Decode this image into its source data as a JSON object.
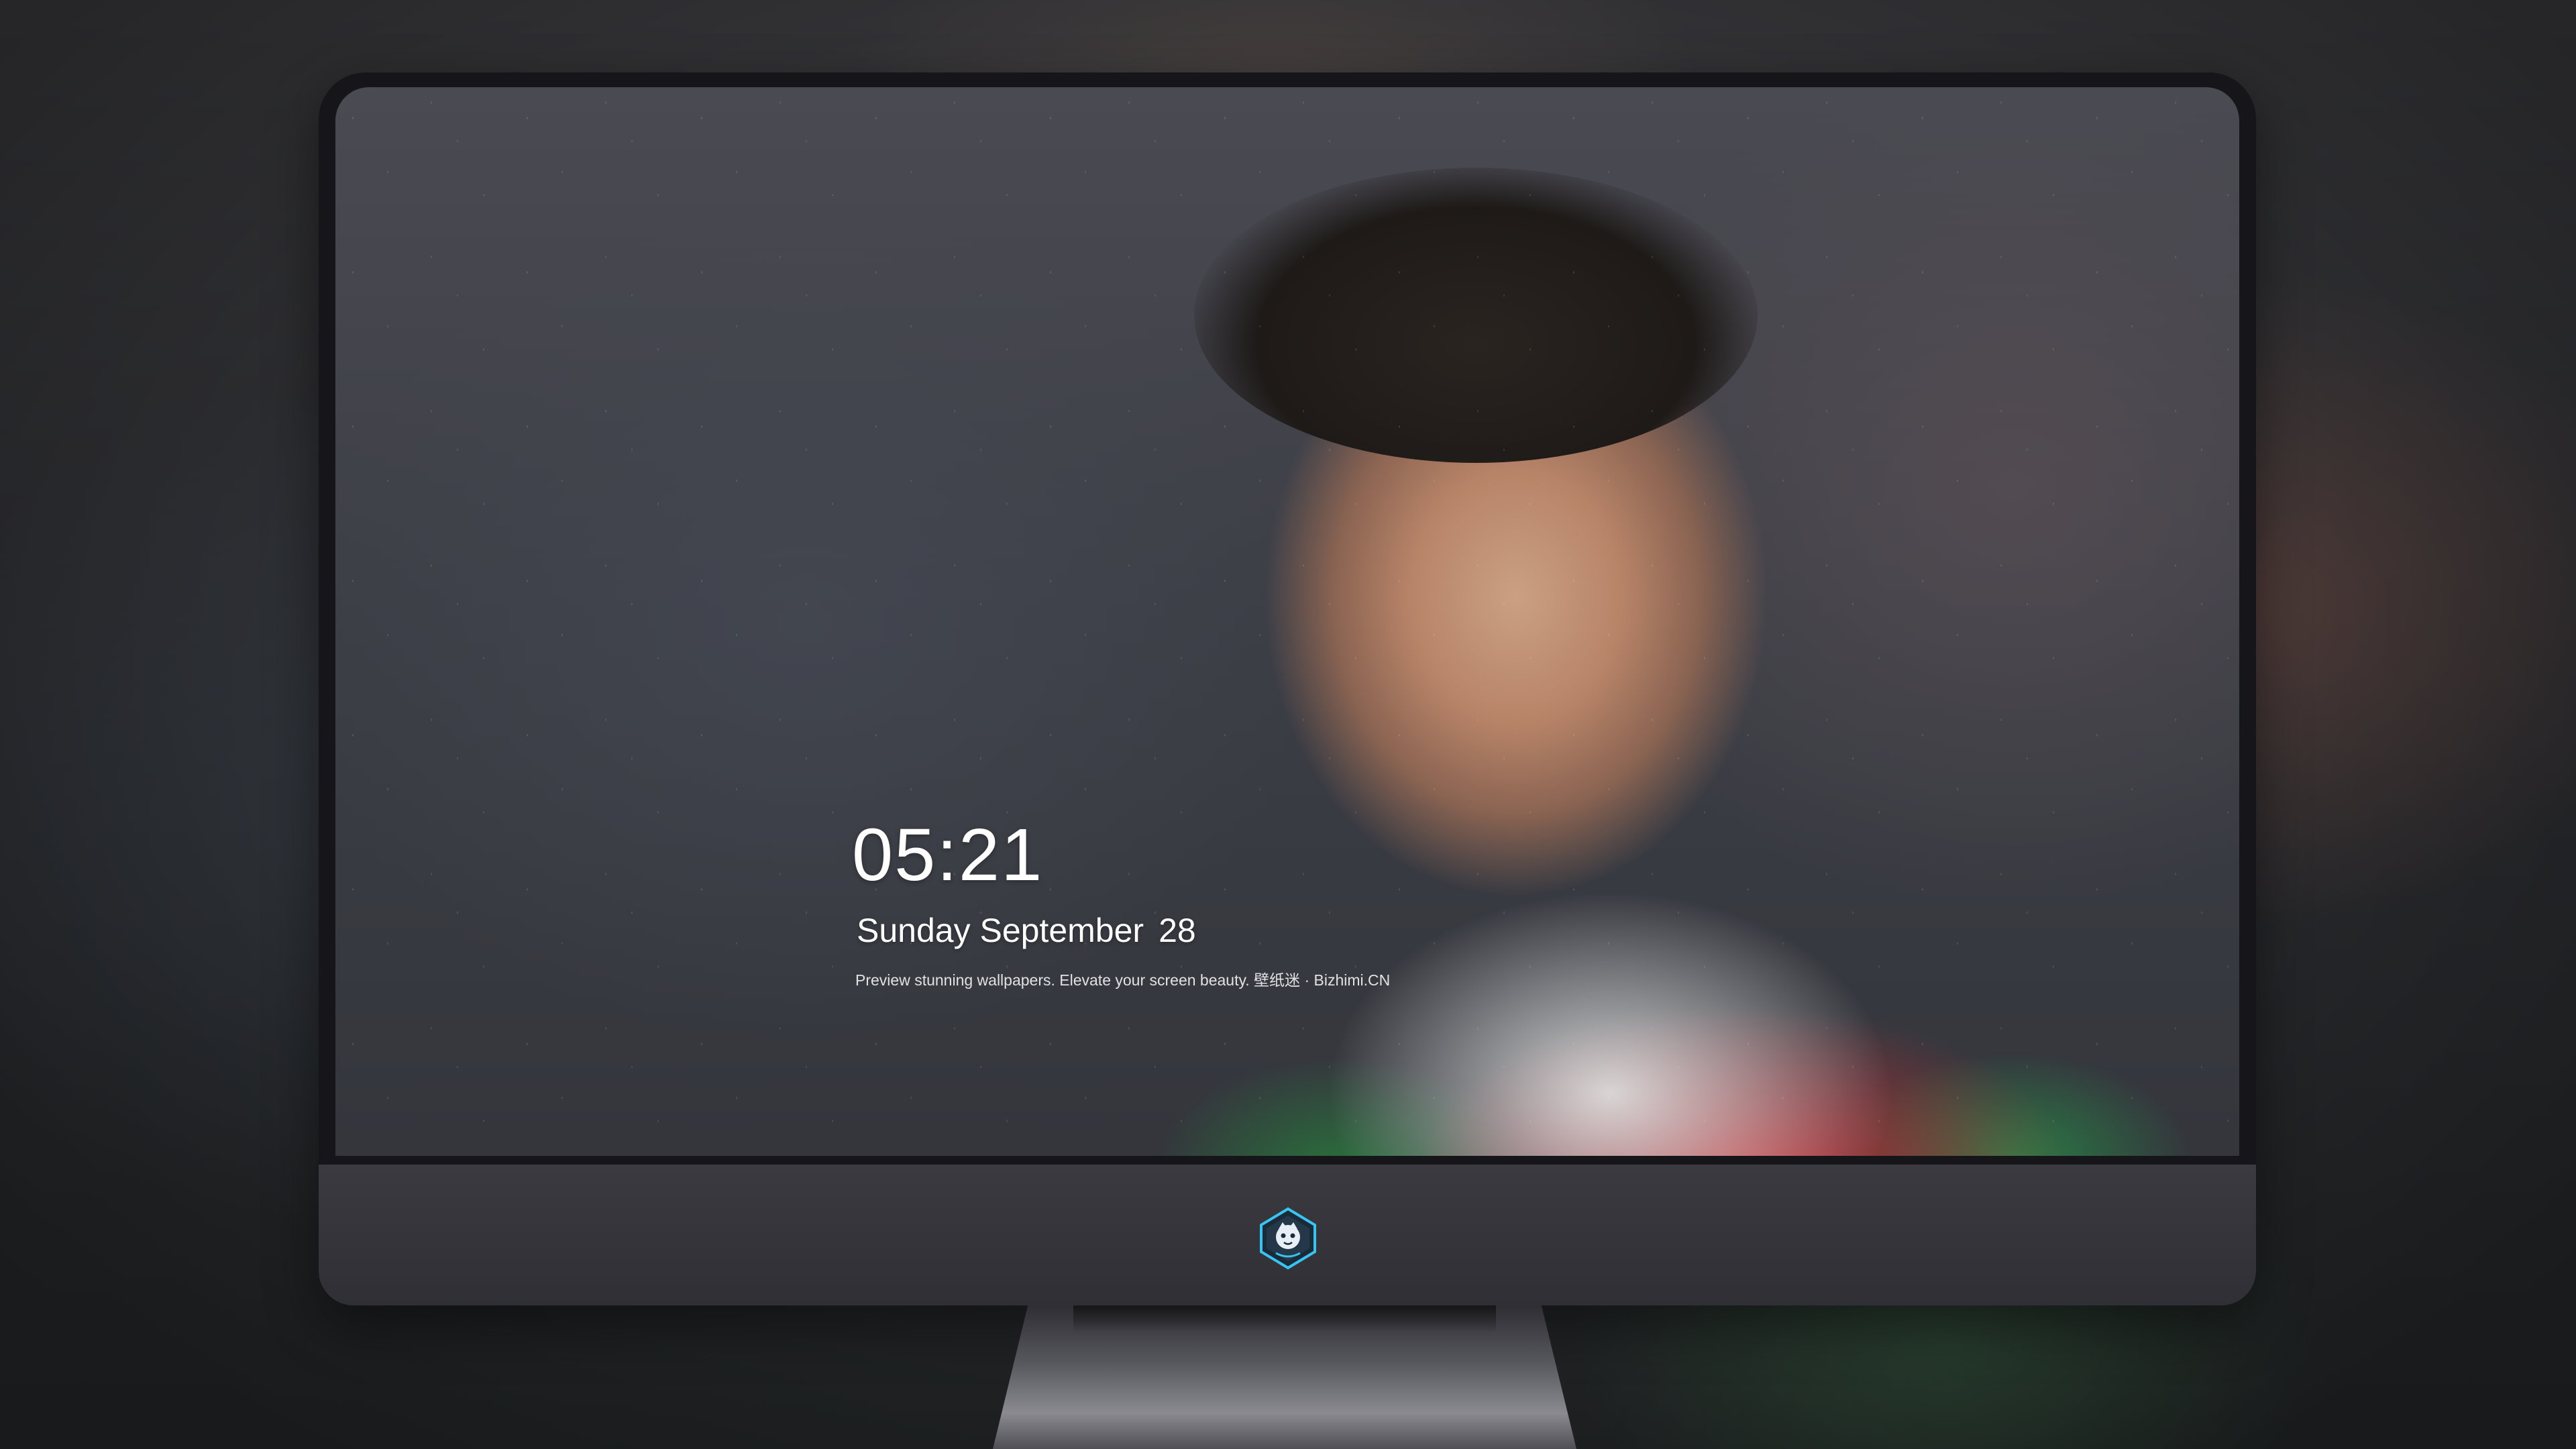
{
  "lockscreen": {
    "time": "05:21",
    "weekday_month": "Sunday September",
    "day": "28",
    "tagline": "Preview stunning wallpapers. Elevate your screen beauty. 壁纸迷 · Bizhimi.CN"
  },
  "dock": {
    "icons": [
      {
        "name": "messages-icon"
      },
      {
        "name": "weather-icon"
      },
      {
        "name": "clock-icon"
      },
      {
        "name": "preview-icon"
      },
      {
        "name": "clips-icon"
      },
      {
        "name": "notes-icon"
      },
      {
        "name": "photos-icon"
      },
      {
        "name": "music-icon"
      },
      {
        "name": "app-store-icon"
      },
      {
        "name": "camera-icon"
      }
    ]
  },
  "colors": {
    "bezel": "#16161a",
    "chin": "#34343a",
    "text": "#ffffff"
  }
}
